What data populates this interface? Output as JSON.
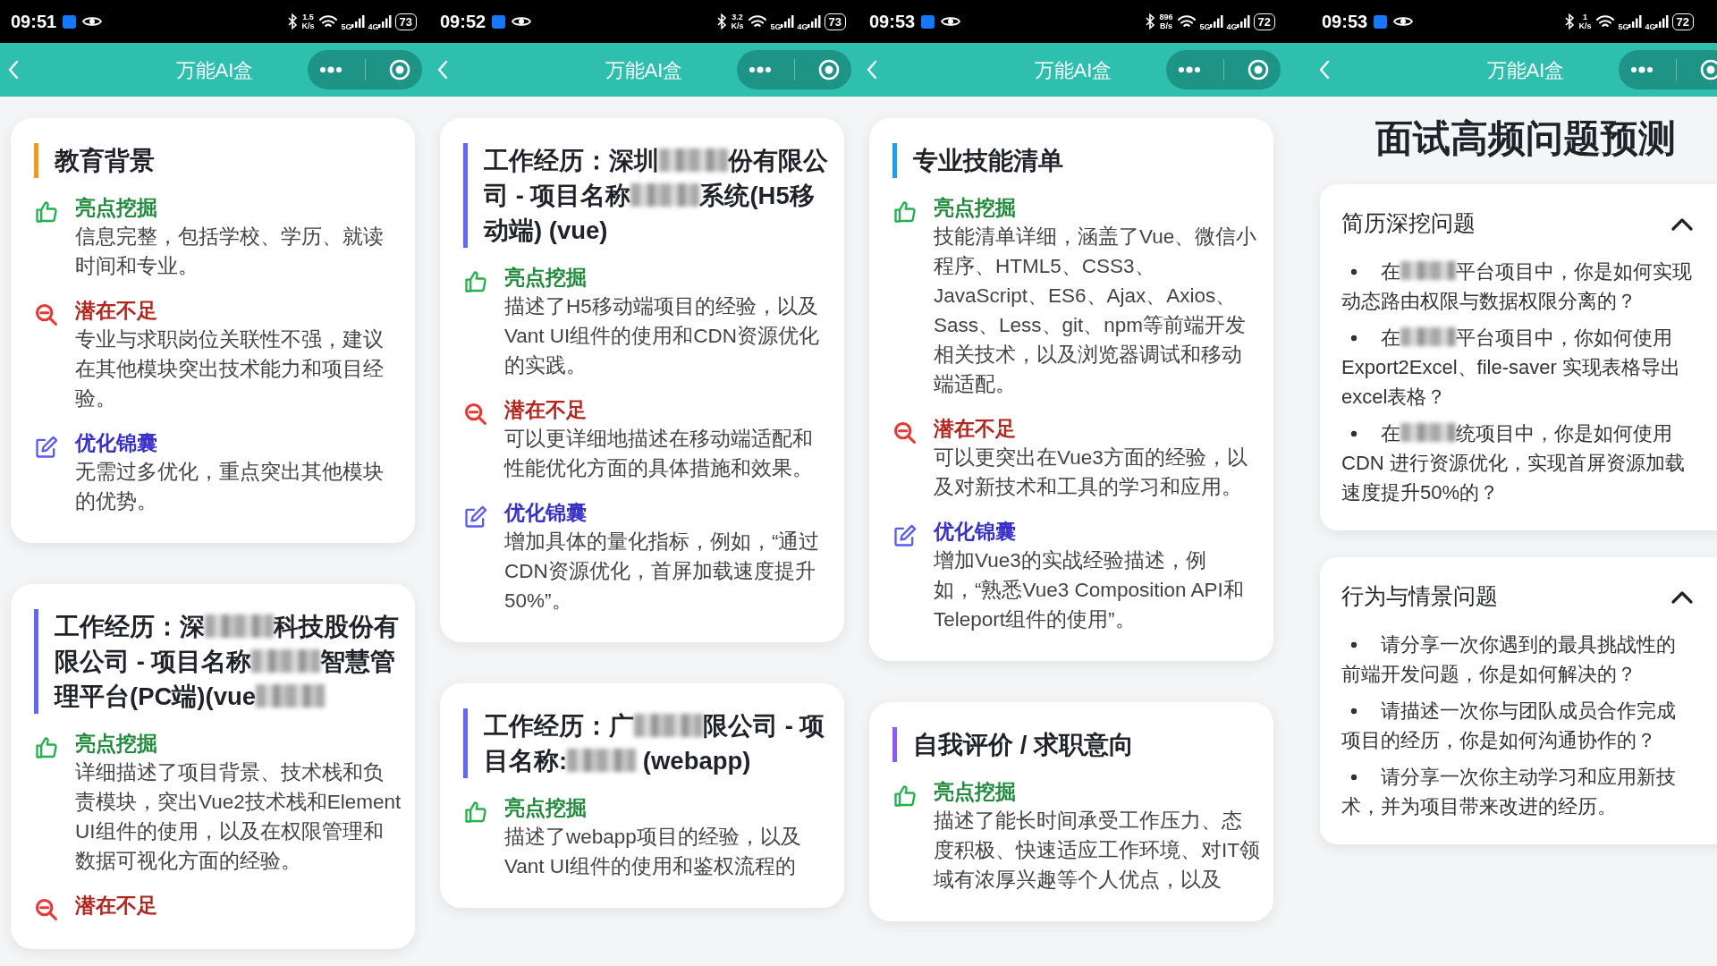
{
  "phones": [
    {
      "status_bar": {
        "time": "09:51",
        "speed": "1.5",
        "speed_unit": "K/s",
        "network_labels": [
          "5G",
          "4G"
        ],
        "battery": "73"
      },
      "nav_bar": {
        "title": "万能AI盒"
      },
      "cards": [
        {
          "kind": "review",
          "color": "#f29a1a",
          "title": [
            {
              "kind": "text",
              "text": "教育背景"
            }
          ],
          "items": [
            {
              "kind": "highlight",
              "label": "亮点挖掘",
              "text": "信息完整，包括学校、学历、就读时间和专业。"
            },
            {
              "kind": "weakness",
              "label": "潜在不足",
              "text": "专业与求职岗位关联性不强，建议在其他模块突出技术能力和项目经验。"
            },
            {
              "kind": "tip",
              "label": "优化锦囊",
              "text": "无需过多优化，重点突出其他模块的优势。"
            }
          ]
        },
        {
          "kind": "review",
          "color": "#6366f1",
          "title": [
            {
              "kind": "text",
              "text": "工作经历：深"
            },
            {
              "kind": "redaction"
            },
            {
              "kind": "text",
              "text": "科技股份有限公司 - 项目名称"
            },
            {
              "kind": "redaction"
            },
            {
              "kind": "text",
              "text": "智慧管理平台(PC端)(vue"
            },
            {
              "kind": "redaction"
            }
          ],
          "items": [
            {
              "kind": "highlight",
              "label": "亮点挖掘",
              "text": "详细描述了项目背景、技术栈和负责模块，突出Vue2技术栈和Element UI组件的使用，以及在权限管理和数据可视化方面的经验。"
            },
            {
              "kind": "weakness",
              "label": "潜在不足"
            }
          ]
        }
      ]
    },
    {
      "status_bar": {
        "time": "09:52",
        "speed": "3.2",
        "speed_unit": "K/s",
        "network_labels": [
          "5G",
          "4G"
        ],
        "battery": "73"
      },
      "nav_bar": {
        "title": "万能AI盒"
      },
      "cards": [
        {
          "kind": "review",
          "color": "#6366f1",
          "title": [
            {
              "kind": "text",
              "text": "工作经历：深圳"
            },
            {
              "kind": "redaction"
            },
            {
              "kind": "text",
              "text": "份有限公司 - 项目名称"
            },
            {
              "kind": "redaction"
            },
            {
              "kind": "text",
              "text": "系统(H5移动端) (vue)"
            }
          ],
          "items": [
            {
              "kind": "highlight",
              "label": "亮点挖掘",
              "text": "描述了H5移动端项目的经验，以及Vant UI组件的使用和CDN资源优化的实践。"
            },
            {
              "kind": "weakness",
              "label": "潜在不足",
              "text": "可以更详细地描述在移动端适配和性能优化方面的具体措施和效果。"
            },
            {
              "kind": "tip",
              "label": "优化锦囊",
              "text": "增加具体的量化指标，例如，“通过CDN资源优化，首屏加载速度提升50%”。"
            }
          ]
        },
        {
          "kind": "review",
          "color": "#6366f1",
          "title": [
            {
              "kind": "text",
              "text": "工作经历：广"
            },
            {
              "kind": "redaction"
            },
            {
              "kind": "text",
              "text": "限公司 - 项目名称:"
            },
            {
              "kind": "redaction"
            },
            {
              "kind": "text",
              "text": " (webapp)"
            }
          ],
          "items": [
            {
              "kind": "highlight",
              "label": "亮点挖掘",
              "text": "描述了webapp项目的经验，以及Vant UI组件的使用和鉴权流程的"
            }
          ]
        }
      ]
    },
    {
      "status_bar": {
        "time": "09:53",
        "speed": "896",
        "speed_unit": "B/s",
        "network_labels": [
          "5G",
          "4G"
        ],
        "battery": "72"
      },
      "nav_bar": {
        "title": "万能AI盒"
      },
      "cards": [
        {
          "kind": "review",
          "color": "#1ea0e6",
          "title": [
            {
              "kind": "text",
              "text": "专业技能清单"
            }
          ],
          "items": [
            {
              "kind": "highlight",
              "label": "亮点挖掘",
              "text": "技能清单详细，涵盖了Vue、微信小程序、HTML5、CSS3、JavaScript、ES6、Ajax、Axios、Sass、Less、git、npm等前端开发相关技术，以及浏览器调试和移动端适配。"
            },
            {
              "kind": "weakness",
              "label": "潜在不足",
              "text": "可以更突出在Vue3方面的经验，以及对新技术和工具的学习和应用。"
            },
            {
              "kind": "tip",
              "label": "优化锦囊",
              "text": "增加Vue3的实战经验描述，例如，“熟悉Vue3 Composition API和Teleport组件的使用”。"
            }
          ]
        },
        {
          "kind": "review",
          "color": "#8b5cf6",
          "title": [
            {
              "kind": "text",
              "text": "自我评价 / 求职意向"
            }
          ],
          "items": [
            {
              "kind": "highlight",
              "label": "亮点挖掘",
              "text": "描述了能长时间承受工作压力、态度积极、快速适应工作环境、对IT领域有浓厚兴趣等个人优点，以及"
            }
          ]
        }
      ]
    },
    {
      "status_bar": {
        "time": "09:53",
        "speed": "1",
        "speed_unit": "K/s",
        "network_labels": [
          "5G",
          "4G"
        ],
        "battery": "72"
      },
      "nav_bar": {
        "title": "万能AI盒"
      },
      "page_title": "面试高频问题预测",
      "cards": [
        {
          "kind": "questions",
          "title": "简历深挖问题",
          "expanded": true,
          "questions": [
            [
              {
                "kind": "text",
                "text": "在"
              },
              {
                "kind": "redaction"
              },
              {
                "kind": "text",
                "text": "平台项目中，你是如何实现动态路由权限与数据权限分离的？"
              }
            ],
            [
              {
                "kind": "text",
                "text": "在"
              },
              {
                "kind": "redaction"
              },
              {
                "kind": "text",
                "text": "平台项目中，你如何使用Export2Excel、file-saver 实现表格导出excel表格？"
              }
            ],
            [
              {
                "kind": "text",
                "text": "在"
              },
              {
                "kind": "redaction"
              },
              {
                "kind": "text",
                "text": "统项目中，你是如何使用CDN 进行资源优化，实现首屏资源加载速度提升50%的？"
              }
            ]
          ]
        },
        {
          "kind": "questions",
          "title": "行为与情景问题",
          "expanded": true,
          "questions": [
            [
              {
                "kind": "text",
                "text": "请分享一次你遇到的最具挑战性的前端开发问题，你是如何解决的？"
              }
            ],
            [
              {
                "kind": "text",
                "text": "请描述一次你与团队成员合作完成项目的经历，你是如何沟通协作的？"
              }
            ],
            [
              {
                "kind": "text",
                "text": "请分享一次你主动学习和应用新技术，并为项目带来改进的经历。"
              }
            ]
          ]
        }
      ]
    }
  ]
}
